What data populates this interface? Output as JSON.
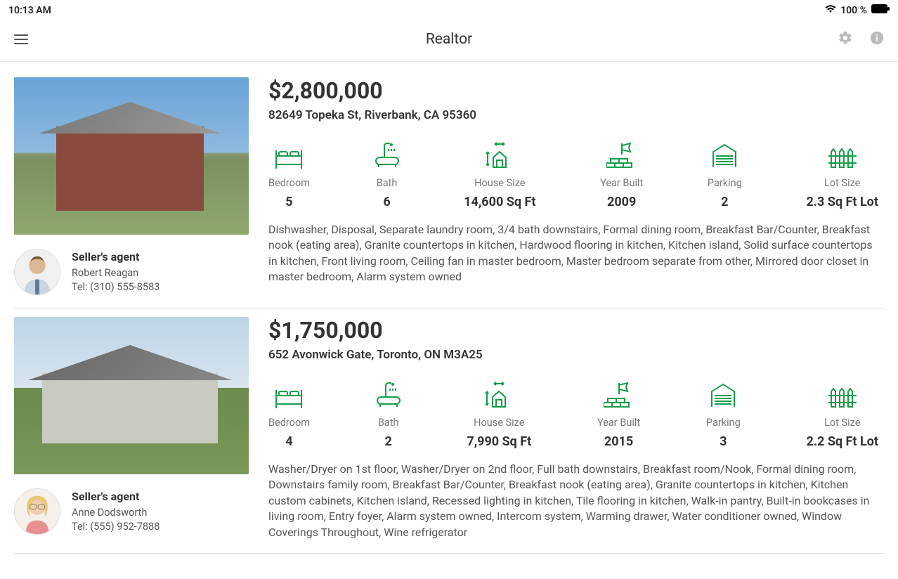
{
  "status": {
    "time": "10:13 AM",
    "battery": "100 %"
  },
  "header": {
    "title": "Realtor"
  },
  "listings": [
    {
      "price": "$2,800,000",
      "address": "82649 Topeka St, Riverbank, CA 95360",
      "stats": [
        {
          "label": "Bedroom",
          "value": "5"
        },
        {
          "label": "Bath",
          "value": "6"
        },
        {
          "label": "House Size",
          "value": "14,600 Sq Ft"
        },
        {
          "label": "Year Built",
          "value": "2009"
        },
        {
          "label": "Parking",
          "value": "2"
        },
        {
          "label": "Lot Size",
          "value": "2.3 Sq Ft Lot"
        }
      ],
      "description": "Dishwasher, Disposal, Separate laundry room, 3/4 bath downstairs, Formal dining room, Breakfast Bar/Counter, Breakfast nook (eating area), Granite countertops in kitchen, Hardwood flooring in kitchen, Kitchen island, Solid surface countertops in kitchen, Front living room, Ceiling fan in master bedroom, Master bedroom separate from other, Mirrored door closet in master bedroom, Alarm system owned",
      "agent": {
        "role": "Seller's agent",
        "name": "Robert Reagan",
        "tel": "Tel: (310) 555-8583"
      }
    },
    {
      "price": "$1,750,000",
      "address": "652 Avonwick Gate, Toronto, ON M3A25",
      "stats": [
        {
          "label": "Bedroom",
          "value": "4"
        },
        {
          "label": "Bath",
          "value": "2"
        },
        {
          "label": "House Size",
          "value": "7,990 Sq Ft"
        },
        {
          "label": "Year Built",
          "value": "2015"
        },
        {
          "label": "Parking",
          "value": "3"
        },
        {
          "label": "Lot Size",
          "value": "2.2 Sq Ft Lot"
        }
      ],
      "description": "Washer/Dryer on 1st floor, Washer/Dryer on 2nd floor, Full bath downstairs, Breakfast room/Nook, Formal dining room, Downstairs family room, Breakfast Bar/Counter, Breakfast nook (eating area), Granite countertops in kitchen, Kitchen custom cabinets, Kitchen island, Recessed lighting in kitchen, Tile flooring in kitchen, Walk-in pantry, Built-in bookcases in living room, Entry foyer, Alarm system owned, Intercom system, Warming drawer, Water conditioner owned, Window Coverings Throughout, Wine refrigerator",
      "agent": {
        "role": "Seller's agent",
        "name": "Anne Dodsworth",
        "tel": "Tel: (555) 952-7888"
      }
    }
  ]
}
